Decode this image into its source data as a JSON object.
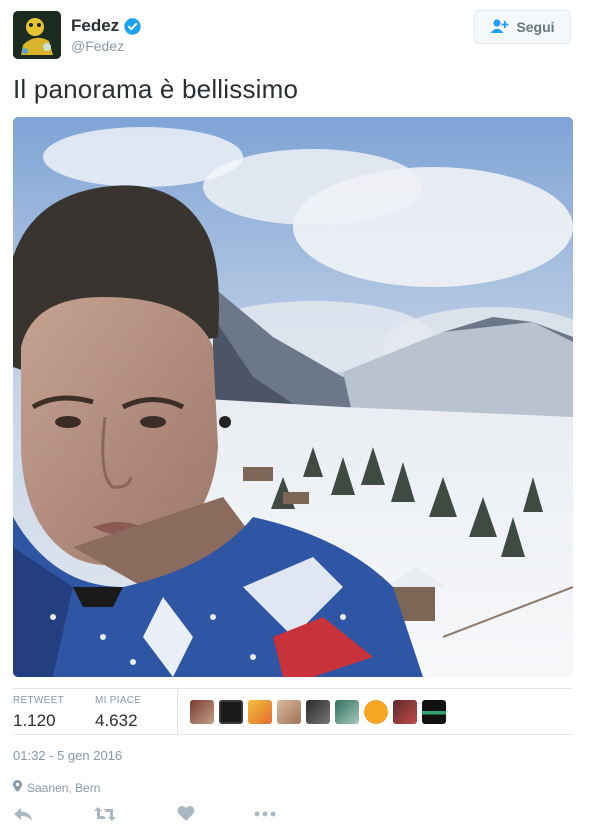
{
  "header": {
    "display_name": "Fedez",
    "handle": "@Fedez",
    "follow_label": "Segui"
  },
  "tweet": {
    "text": "Il panorama è bellissimo"
  },
  "stats": {
    "retweet_label": "RETWEET",
    "retweet_count": "1.120",
    "likes_label": "MI PIACE",
    "likes_count": "4.632"
  },
  "likers": [
    "liker-1",
    "liker-2",
    "liker-3",
    "liker-4",
    "liker-5",
    "liker-6",
    "liker-7",
    "liker-8",
    "liker-9"
  ],
  "meta": {
    "timestamp": "01:32 - 5 gen 2016",
    "location": "Saanen, Bern"
  },
  "actions": [
    "reply-icon",
    "retweet-icon",
    "like-icon",
    "more-icon"
  ],
  "colors": {
    "verified": "#1da1f2",
    "secondary_text": "#8899a6",
    "border": "#e1e8ed"
  }
}
